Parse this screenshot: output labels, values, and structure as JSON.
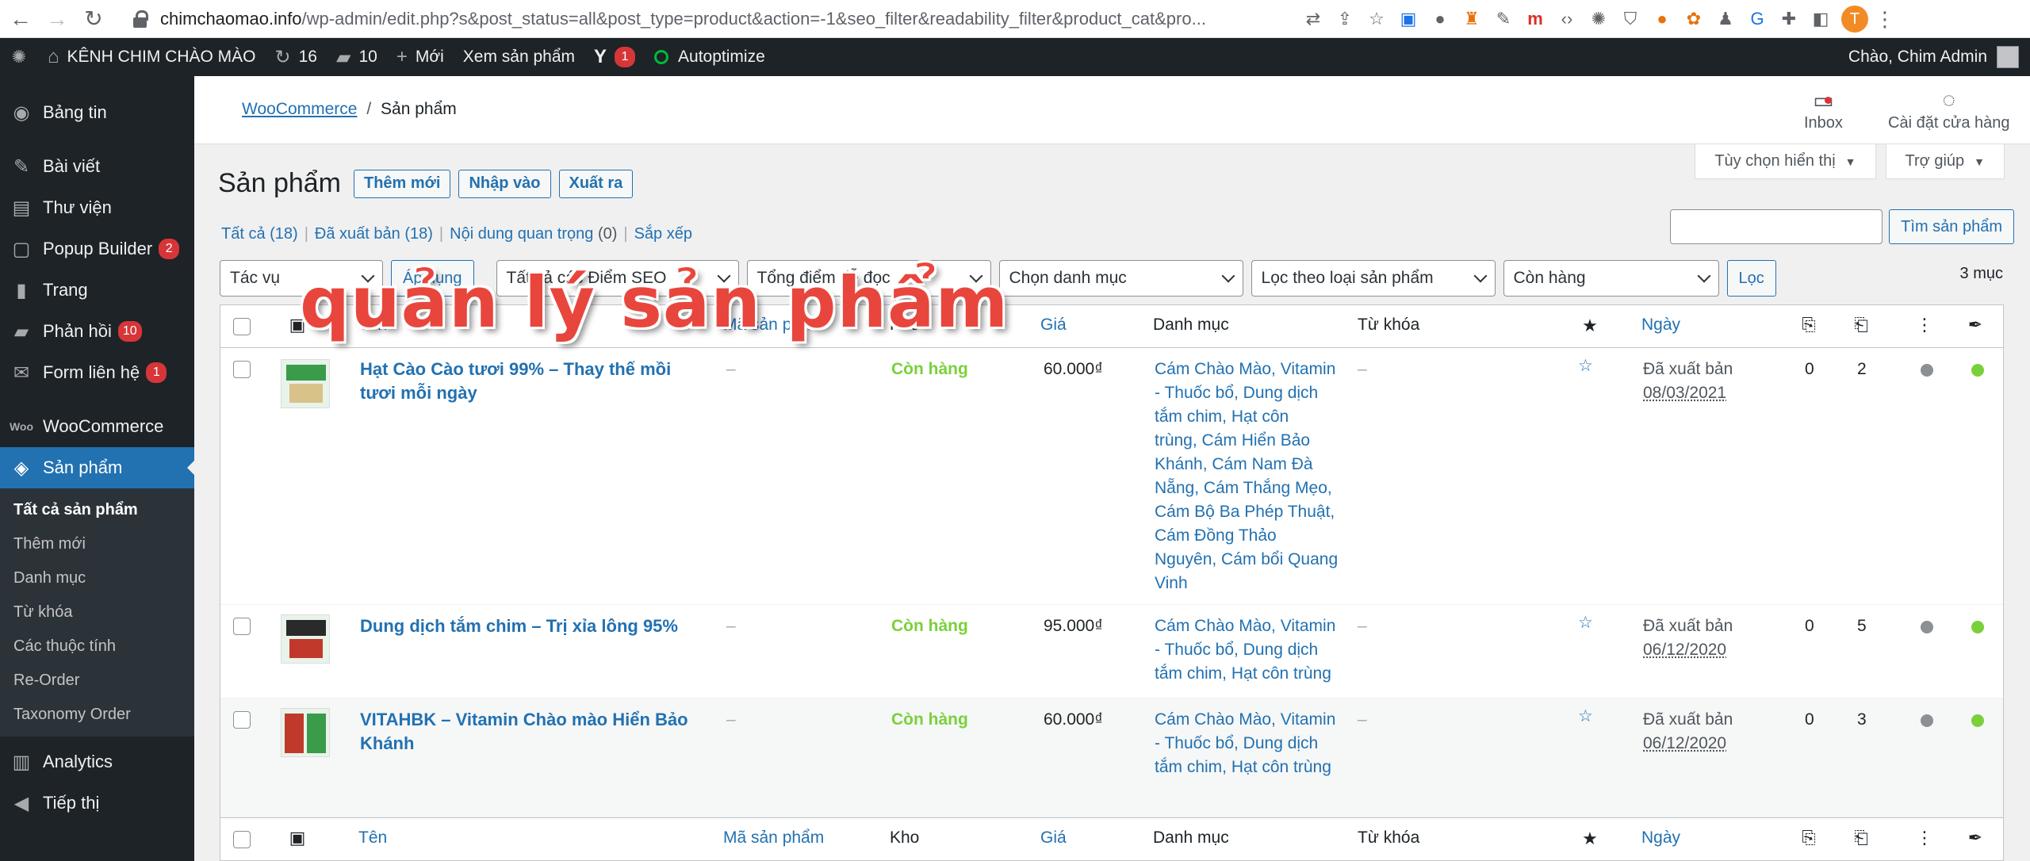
{
  "browser": {
    "url_host": "chimchaomao.info",
    "url_path": "/wp-admin/edit.php?s&post_status=all&post_type=product&action=-1&seo_filter&readability_filter&product_cat&pro...",
    "profile_initial": "T"
  },
  "adminbar": {
    "site_name": "KÊNH CHIM CHÀO MÀO",
    "updates_count": "16",
    "comments_count": "10",
    "new_label": "Mới",
    "view_products": "Xem sản phẩm",
    "yoast_count": "1",
    "autoptimize": "Autoptimize",
    "greeting": "Chào, Chim Admin"
  },
  "sidebar": {
    "items": [
      {
        "label": "Bảng tin"
      },
      {
        "label": "Bài viết"
      },
      {
        "label": "Thư viện"
      },
      {
        "label": "Popup Builder",
        "count": "2"
      },
      {
        "label": "Trang"
      },
      {
        "label": "Phản hồi",
        "count": "10"
      },
      {
        "label": "Form liên hệ",
        "count": "1"
      },
      {
        "label": "WooCommerce"
      },
      {
        "label": "Sản phẩm"
      }
    ],
    "submenu": [
      "Tất cả sản phẩm",
      "Thêm mới",
      "Danh mục",
      "Từ khóa",
      "Các thuộc tính",
      "Re-Order",
      "Taxonomy Order"
    ],
    "bottom": [
      {
        "label": "Analytics"
      },
      {
        "label": "Tiếp thị"
      }
    ]
  },
  "wc_header": {
    "breadcrumb_link": "WooCommerce",
    "breadcrumb_sep": "/",
    "breadcrumb_current": "Sản phẩm",
    "inbox": "Inbox",
    "store_setup": "Cài đặt cửa hàng"
  },
  "screen_tabs": {
    "options": "Tùy chọn hiển thị",
    "help": "Trợ giúp"
  },
  "page": {
    "title": "Sản phẩm",
    "add_new": "Thêm mới",
    "import": "Nhập vào",
    "export": "Xuất ra"
  },
  "views": {
    "all": "Tất cả",
    "all_count": "(18)",
    "published": "Đã xuất bản",
    "published_count": "(18)",
    "cornerstone": "Nội dung quan trọng",
    "cornerstone_count": "(0)",
    "sorting": "Sắp xếp"
  },
  "search": {
    "button": "Tìm sản phẩm",
    "value": ""
  },
  "filters": {
    "bulk_action": "Tác vụ",
    "apply": "Áp dụng",
    "seo": "Tất cả các Điểm SEO",
    "readability": "Tổng điểm dễ đọc",
    "category": "Chọn danh mục",
    "product_type": "Lọc theo loại sản phẩm",
    "stock": "Còn hàng",
    "filter_button": "Lọc",
    "items_count": "3 mục"
  },
  "table": {
    "columns": {
      "name": "Tên",
      "sku": "Mã sản phẩm",
      "stock": "Kho",
      "price": "Giá",
      "categories": "Danh mục",
      "tags": "Từ khóa",
      "date": "Ngày"
    },
    "rows": [
      {
        "name_line1": "Hạt Cào Cào tươi 99% – Thay thế mồi",
        "name_line2": "tươi mỗi ngày",
        "sku": "–",
        "stock": "Còn hàng",
        "price": "60.000₫",
        "categories": [
          "Cám Chào Mào, Vitamin",
          "- Thuốc bổ, Dung dịch",
          "tắm chim, Hạt côn",
          "trùng, Cám Hiển Bảo",
          "Khánh, Cám Nam Đà",
          "Nẵng, Cám Thắng Mẹo,",
          "Cám Bộ Ba Phép Thuật,",
          "Cám Đồng Thảo",
          "Nguyên, Cám bổi Quang",
          "Vinh"
        ],
        "tags": "–",
        "status": "Đã xuất bản",
        "date": "08/03/2021",
        "links_in": "0",
        "links_out": "2",
        "seo_color": "#8c8f94",
        "read_color": "#7ad03a"
      },
      {
        "name_line1": "Dung dịch tắm chim – Trị xỉa lông 95%",
        "name_line2": "",
        "sku": "–",
        "stock": "Còn hàng",
        "price": "95.000₫",
        "categories": [
          "Cám Chào Mào, Vitamin",
          "- Thuốc bổ, Dung dịch",
          "tắm chim, Hạt côn trùng"
        ],
        "tags": "–",
        "status": "Đã xuất bản",
        "date": "06/12/2020",
        "links_in": "0",
        "links_out": "5",
        "seo_color": "#8c8f94",
        "read_color": "#7ad03a"
      },
      {
        "name_line1": "VITAHBK – Vitamin Chào mào Hiển Bảo",
        "name_line2": "Khánh",
        "sku": "–",
        "stock": "Còn hàng",
        "price": "60.000₫",
        "categories": [
          "Cám Chào Mào, Vitamin",
          "- Thuốc bổ, Dung dịch",
          "tắm chim, Hạt côn trùng"
        ],
        "tags": "–",
        "status": "Đã xuất bản",
        "date": "06/12/2020",
        "links_in": "0",
        "links_out": "3",
        "seo_color": "#8c8f94",
        "read_color": "#7ad03a"
      }
    ]
  },
  "overlay_caption": "quản lý sản phẩm",
  "colors": {
    "accent": "#2271b1",
    "admin_bg": "#1d2327",
    "instock": "#7ad03a",
    "overlay": "#e8463d"
  }
}
